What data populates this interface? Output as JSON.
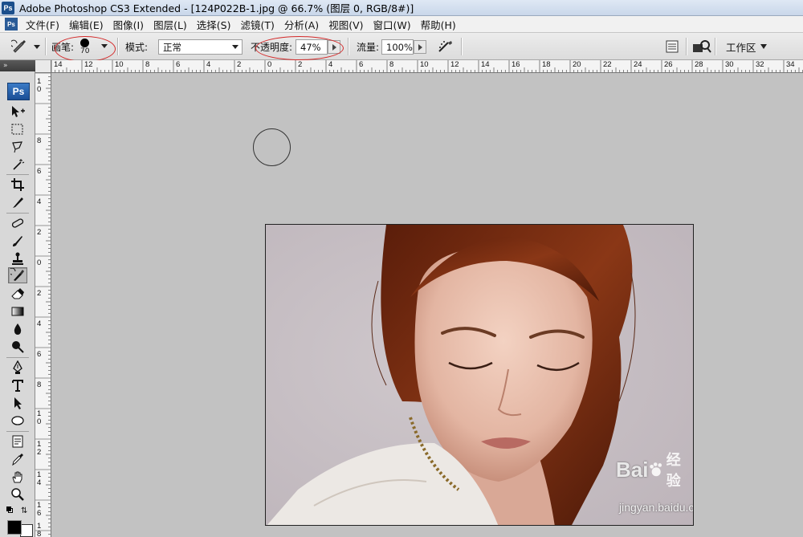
{
  "titlebar": {
    "app_badge": "Ps",
    "title": "Adobe Photoshop CS3 Extended - [124P022B-1.jpg @ 66.7% (图层 0, RGB/8#)]"
  },
  "menubar": {
    "items": [
      "文件(F)",
      "编辑(E)",
      "图像(I)",
      "图层(L)",
      "选择(S)",
      "滤镜(T)",
      "分析(A)",
      "视图(V)",
      "窗口(W)",
      "帮助(H)"
    ]
  },
  "options": {
    "brush_label": "画笔:",
    "brush_size": "70",
    "mode_label": "模式:",
    "mode_value": "正常",
    "opacity_label": "不透明度:",
    "opacity_value": "47%",
    "flow_label": "流量:",
    "flow_value": "100%",
    "workspace_label": "工作区"
  },
  "rulers": {
    "top_labels": [
      "14",
      "12",
      "10",
      "8",
      "6",
      "4",
      "2",
      "0",
      "2",
      "4",
      "6",
      "8",
      "10",
      "12",
      "14",
      "16",
      "18",
      "20",
      "22",
      "24",
      "26",
      "28",
      "30",
      "32",
      "34"
    ],
    "left_labels": [
      "1",
      "0",
      "8",
      "6",
      "4",
      "2",
      "0",
      "2",
      "4",
      "6",
      "8",
      "1",
      "0",
      "1",
      "2",
      "1",
      "4",
      "1",
      "6",
      "1",
      "8"
    ]
  },
  "toolbox": {
    "logo": "Ps",
    "tools": [
      "move-tool",
      "marquee-tool",
      "lasso-tool",
      "magic-wand-tool",
      "crop-tool",
      "slice-tool",
      "healing-tool",
      "brush-tool",
      "clone-stamp-tool",
      "history-brush-tool",
      "eraser-tool",
      "gradient-tool",
      "blur-tool",
      "dodge-tool",
      "pen-tool",
      "type-tool",
      "path-selection-tool",
      "shape-tool",
      "notes-tool",
      "eyedropper-tool",
      "hand-tool",
      "zoom-tool"
    ],
    "active_tool": "history-brush-tool",
    "foreground_color": "#000000",
    "background_color": "#ffffff"
  },
  "watermark": {
    "brand": "Bai",
    "brand2": "经验",
    "url": "jingyan.baidu.com"
  },
  "colors": {
    "highlight_ellipse": "#d42a2a",
    "canvas_bg": "#c2c2c2",
    "photo_bg": "#c9c2c6",
    "hair": "#7a2a10"
  }
}
